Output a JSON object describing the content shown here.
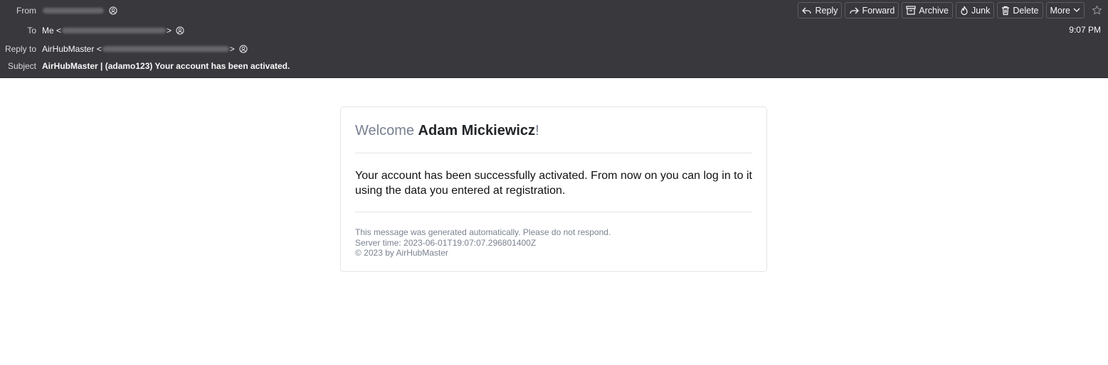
{
  "header": {
    "from_label": "From",
    "to_label": "To",
    "to_name": "Me <",
    "to_suffix": ">",
    "reply_to_label": "Reply to",
    "reply_to_name": "AirHubMaster <",
    "reply_to_suffix": ">",
    "subject_label": "Subject",
    "subject": "AirHubMaster | (adamo123) Your account has been activated.",
    "time": "9:07 PM"
  },
  "toolbar": {
    "reply": "Reply",
    "forward": "Forward",
    "archive": "Archive",
    "junk": "Junk",
    "delete": "Delete",
    "more": "More"
  },
  "email": {
    "welcome_prefix": "Welcome ",
    "user_name": "Adam Mickiewicz",
    "welcome_suffix": "!",
    "message": "Your account has been successfully activated. From now on you can log in to it using the data you entered at registration.",
    "footer_line1": "This message was generated automatically. Please do not respond.",
    "footer_line2": "Server time: 2023-06-01T19:07:07.296801400Z",
    "footer_line3": "© 2023 by AirHubMaster"
  },
  "icons": {
    "contact": "contact-icon",
    "reply": "reply-icon",
    "forward": "forward-icon",
    "archive": "archive-icon",
    "junk": "junk-icon",
    "delete": "trash-icon",
    "more": "chevron-down-icon",
    "star": "star-icon"
  },
  "colors": {
    "header_bg": "#38383d",
    "header_text": "#f9f9fa",
    "welcome_gray": "#778091",
    "footer_gray": "#7a828f",
    "card_border": "#e2e4e8"
  }
}
